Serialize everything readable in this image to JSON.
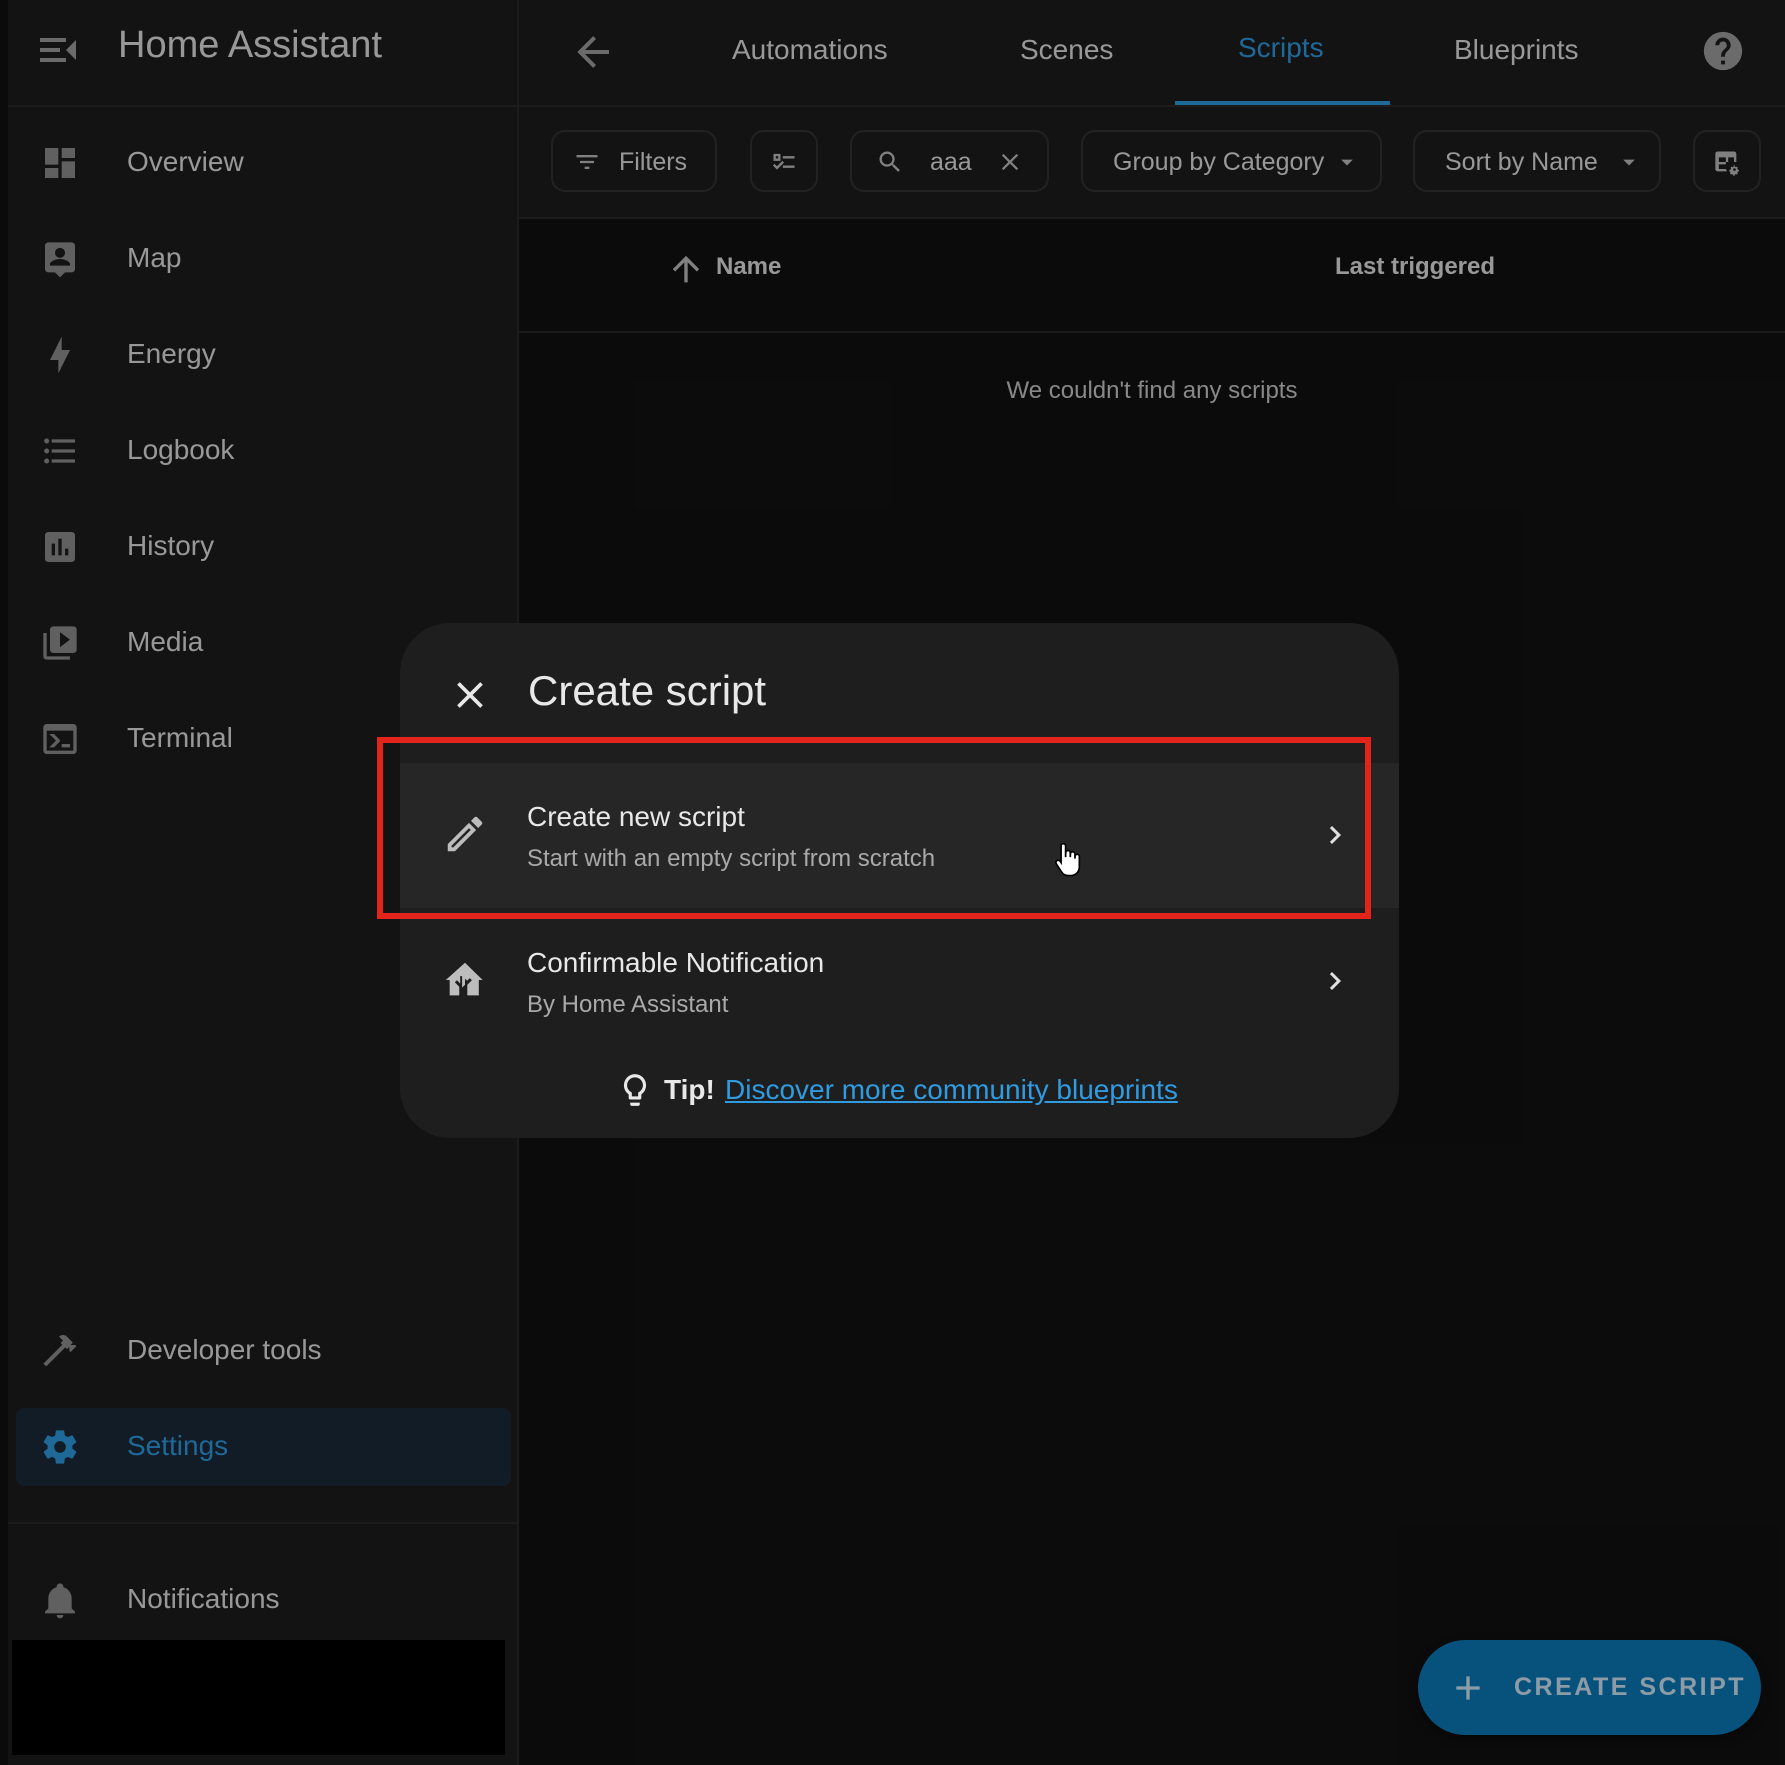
{
  "app": {
    "title": "Home Assistant"
  },
  "sidebar": {
    "items": [
      {
        "label": "Overview",
        "icon": "dashboard-icon"
      },
      {
        "label": "Map",
        "icon": "map-icon"
      },
      {
        "label": "Energy",
        "icon": "lightning-bolt-icon"
      },
      {
        "label": "Logbook",
        "icon": "list-icon"
      },
      {
        "label": "History",
        "icon": "chart-bar-icon"
      },
      {
        "label": "Media",
        "icon": "play-box-icon"
      },
      {
        "label": "Terminal",
        "icon": "console-icon"
      },
      {
        "label": "Developer tools",
        "icon": "hammer-icon"
      },
      {
        "label": "Settings",
        "icon": "gear-icon",
        "active": true
      },
      {
        "label": "Notifications",
        "icon": "bell-icon"
      }
    ]
  },
  "topbar": {
    "tabs": [
      {
        "label": "Automations"
      },
      {
        "label": "Scenes"
      },
      {
        "label": "Scripts",
        "active": true
      },
      {
        "label": "Blueprints"
      }
    ]
  },
  "toolbar": {
    "filters_label": "Filters",
    "search_value": "aaa",
    "group_by_label": "Group by Category",
    "sort_by_label": "Sort by Name"
  },
  "table": {
    "columns": [
      "Name",
      "Last triggered"
    ],
    "sort_direction": "ascending",
    "empty_message": "We couldn't find any scripts"
  },
  "dialog": {
    "title": "Create script",
    "options": [
      {
        "title": "Create new script",
        "subtitle": "Start with an empty script from scratch",
        "icon": "pencil-icon"
      },
      {
        "title": "Confirmable Notification",
        "subtitle": "By Home Assistant",
        "icon": "blueprint-icon"
      }
    ],
    "tip_label": "Tip!",
    "tip_link": "Discover more community blueprints"
  },
  "fab": {
    "label": "CREATE SCRIPT"
  },
  "colors": {
    "accent": "#2f9be1",
    "fab": "#0b7ab9",
    "highlight": "#e3241b",
    "background": "#111111",
    "surface": "#1c1c1c"
  }
}
